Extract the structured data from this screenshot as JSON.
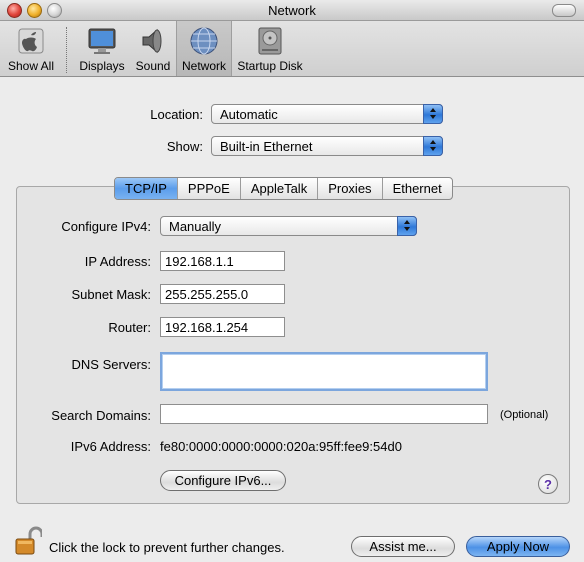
{
  "window": {
    "title": "Network"
  },
  "toolbar": {
    "items": [
      {
        "label": "Show All",
        "icon": "show-all-icon"
      },
      {
        "label": "Displays",
        "icon": "display-icon"
      },
      {
        "label": "Sound",
        "icon": "speaker-icon"
      },
      {
        "label": "Network",
        "icon": "network-globe-icon",
        "selected": true
      },
      {
        "label": "Startup Disk",
        "icon": "hard-disk-icon"
      }
    ]
  },
  "location": {
    "label": "Location:",
    "value": "Automatic"
  },
  "show": {
    "label": "Show:",
    "value": "Built-in Ethernet"
  },
  "tabs": [
    {
      "label": "TCP/IP",
      "active": true
    },
    {
      "label": "PPPoE"
    },
    {
      "label": "AppleTalk"
    },
    {
      "label": "Proxies"
    },
    {
      "label": "Ethernet"
    }
  ],
  "tcpip": {
    "configure_ipv4": {
      "label": "Configure IPv4:",
      "value": "Manually"
    },
    "ip_address": {
      "label": "IP Address:",
      "value": "192.168.1.1"
    },
    "subnet_mask": {
      "label": "Subnet Mask:",
      "value": "255.255.255.0"
    },
    "router": {
      "label": "Router:",
      "value": "192.168.1.254"
    },
    "dns_servers": {
      "label": "DNS Servers:",
      "value": ""
    },
    "search_domains": {
      "label": "Search Domains:",
      "value": "",
      "note": "(Optional)"
    },
    "ipv6_address": {
      "label": "IPv6 Address:",
      "value": "fe80:0000:0000:0000:020a:95ff:fee9:54d0"
    },
    "configure_ipv6_button": "Configure IPv6...",
    "help": "?"
  },
  "footer": {
    "lock_text": "Click the lock to prevent further changes.",
    "assist_button": "Assist me...",
    "apply_button": "Apply Now"
  },
  "colors": {
    "accent": "#4d91e6",
    "window_bg": "#ececec"
  }
}
